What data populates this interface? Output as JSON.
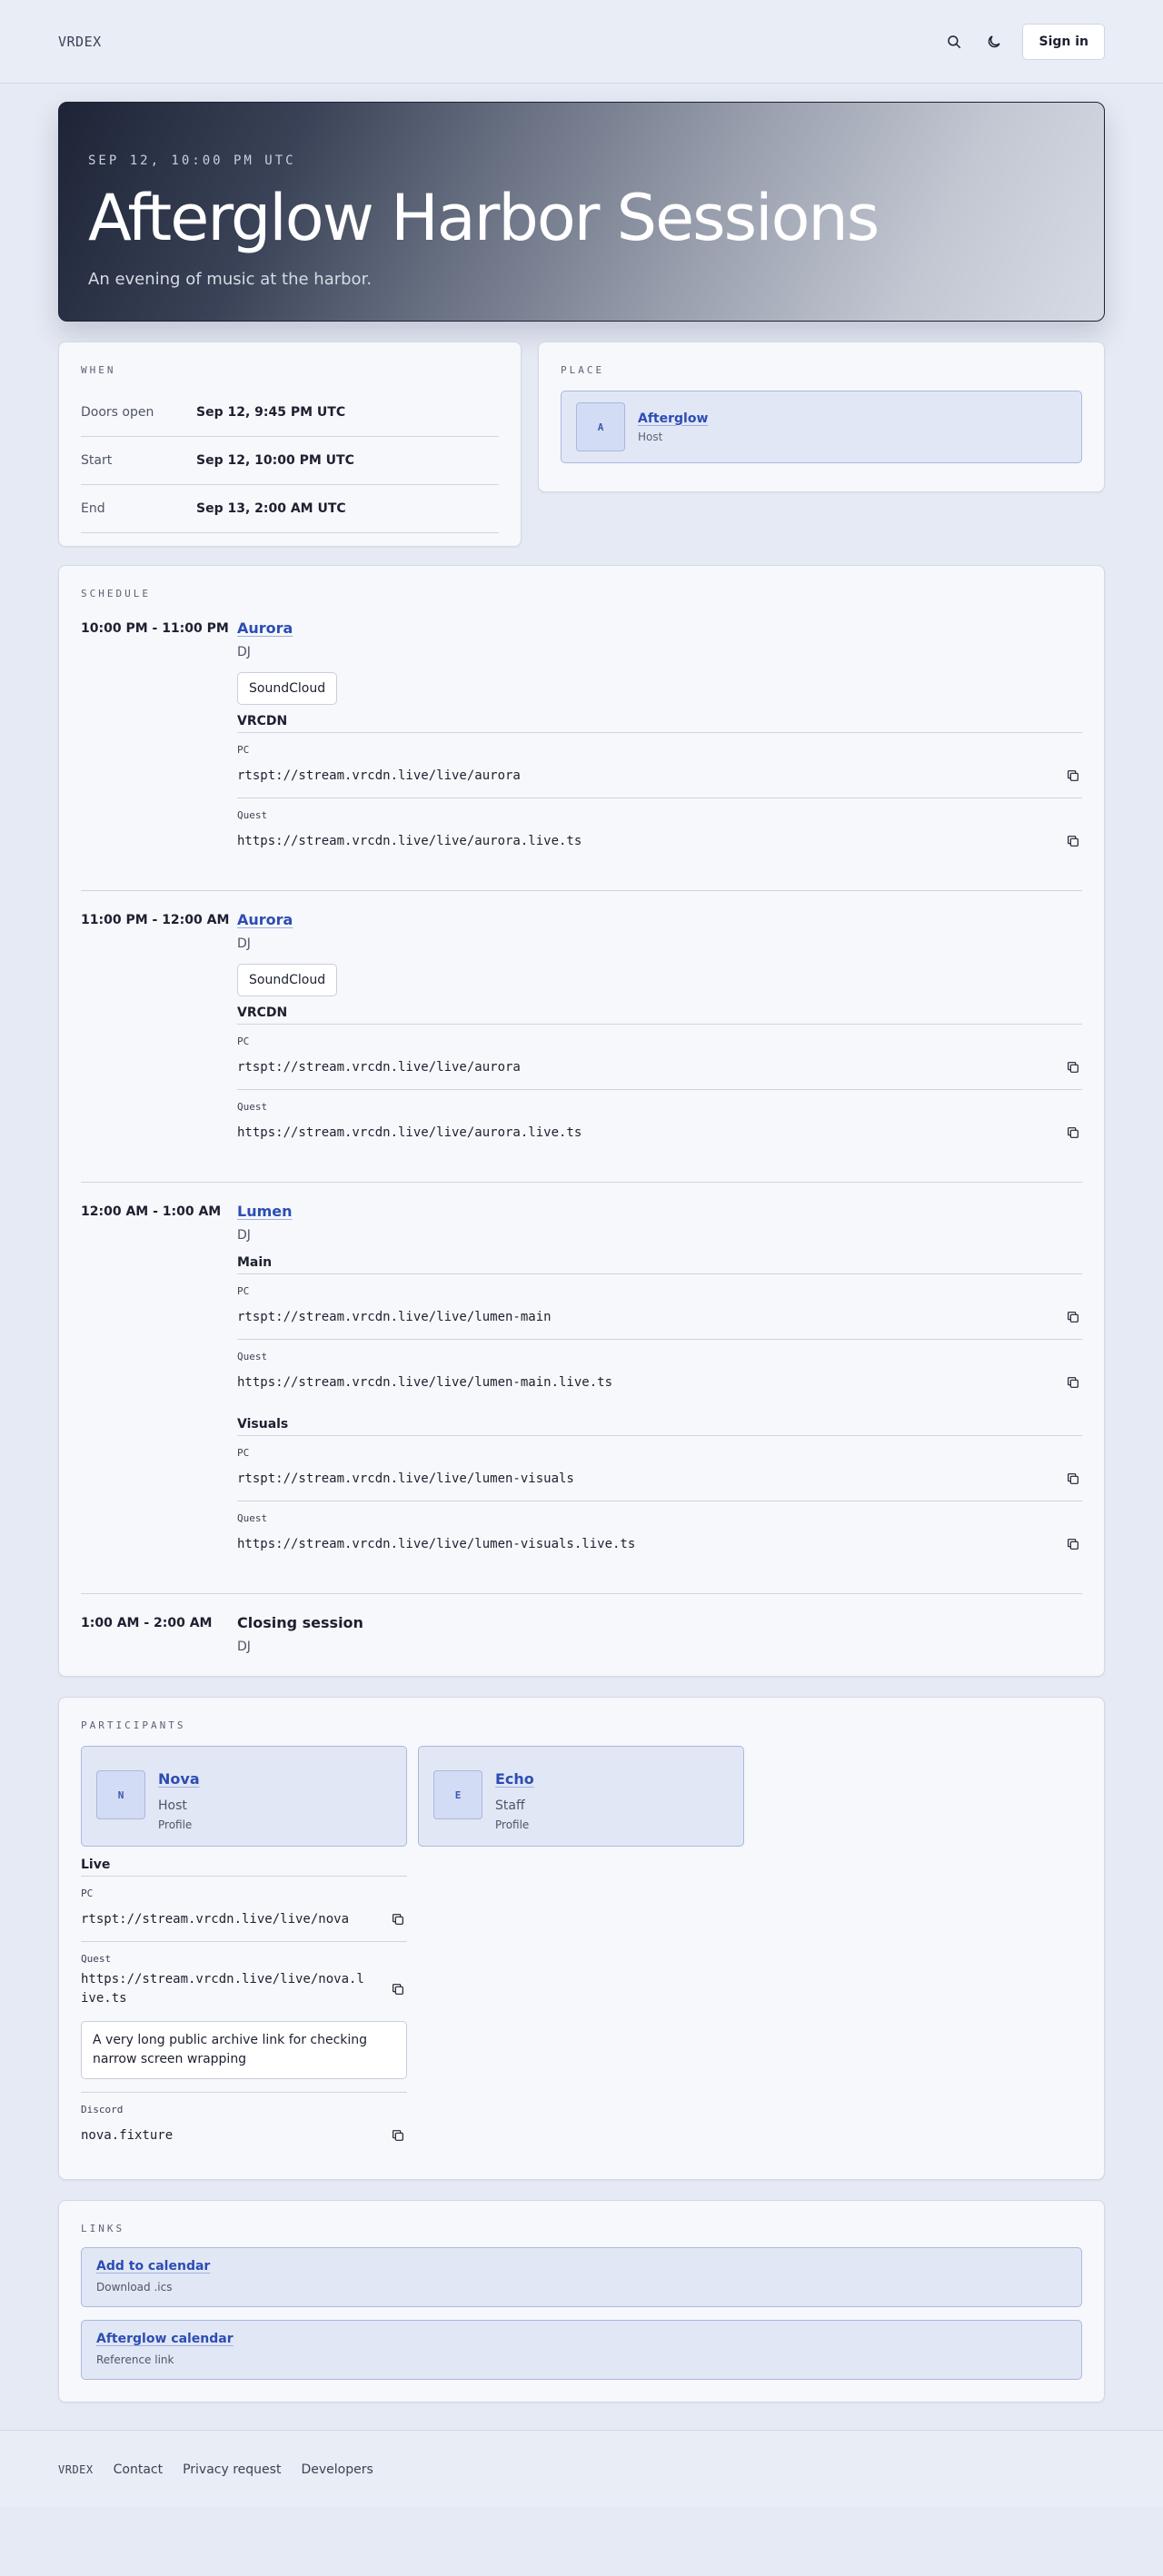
{
  "header": {
    "brand": "VRDEX",
    "signin_label": "Sign in"
  },
  "hero": {
    "date": "SEP 12, 10:00 PM UTC",
    "title": "Afterglow Harbor Sessions",
    "subtitle": "An evening of music at the harbor."
  },
  "when": {
    "label": "WHEN",
    "rows": [
      {
        "key": "Doors open",
        "value": "Sep 12, 9:45 PM UTC"
      },
      {
        "key": "Start",
        "value": "Sep 12, 10:00 PM UTC"
      },
      {
        "key": "End",
        "value": "Sep 13, 2:00 AM UTC"
      }
    ]
  },
  "place": {
    "label": "PLACE",
    "avatar": "A",
    "name": "Afterglow",
    "role": "Host"
  },
  "schedule": {
    "label": "SCHEDULE",
    "slots": [
      {
        "time": "10:00 PM - 11:00 PM",
        "name": "Aurora",
        "role": "DJ",
        "chip": "SoundCloud",
        "group": "VRCDN",
        "pc_label": "PC",
        "pc_url": "rtspt://stream.vrcdn.live/live/aurora",
        "quest_label": "Quest",
        "quest_url": "https://stream.vrcdn.live/live/aurora.live.ts"
      },
      {
        "time": "11:00 PM - 12:00 AM",
        "name": "Aurora",
        "role": "DJ",
        "chip": "SoundCloud",
        "group": "VRCDN",
        "pc_label": "PC",
        "pc_url": "rtspt://stream.vrcdn.live/live/aurora",
        "quest_label": "Quest",
        "quest_url": "https://stream.vrcdn.live/live/aurora.live.ts"
      },
      {
        "time": "12:00 AM - 1:00 AM",
        "name": "Lumen",
        "role": "DJ",
        "group1": "Main",
        "g1_pc_label": "PC",
        "g1_pc_url": "rtspt://stream.vrcdn.live/live/lumen-main",
        "g1_quest_label": "Quest",
        "g1_quest_url": "https://stream.vrcdn.live/live/lumen-main.live.ts",
        "group2": "Visuals",
        "g2_pc_label": "PC",
        "g2_pc_url": "rtspt://stream.vrcdn.live/live/lumen-visuals",
        "g2_quest_label": "Quest",
        "g2_quest_url": "https://stream.vrcdn.live/live/lumen-visuals.live.ts"
      },
      {
        "time": "1:00 AM - 2:00 AM",
        "name": "Closing session",
        "role": "DJ"
      }
    ]
  },
  "participants": {
    "label": "PARTICIPANTS",
    "people": [
      {
        "avatar": "N",
        "name": "Nova",
        "role": "Host",
        "profile": "Profile"
      },
      {
        "avatar": "E",
        "name": "Echo",
        "role": "Staff",
        "profile": "Profile"
      }
    ],
    "live": {
      "title": "Live",
      "pc_label": "PC",
      "pc_url": "rtspt://stream.vrcdn.live/live/nova",
      "quest_label": "Quest",
      "quest_url": "https://stream.vrcdn.live/live/nova.live.ts",
      "archive": "A very long public archive link for checking narrow screen wrapping",
      "discord_label": "Discord",
      "discord_value": "nova.fixture"
    }
  },
  "links": {
    "label": "LINKS",
    "items": [
      {
        "title": "Add to calendar",
        "sub": "Download .ics"
      },
      {
        "title": "Afterglow calendar",
        "sub": "Reference link"
      }
    ]
  },
  "footer": {
    "brand": "VRDEX",
    "links": [
      "Contact",
      "Privacy request",
      "Developers"
    ]
  }
}
